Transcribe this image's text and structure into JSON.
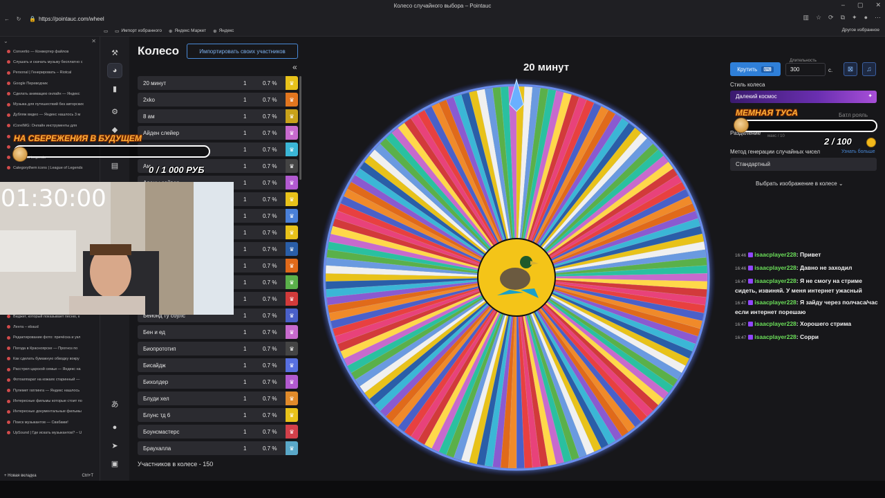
{
  "browser": {
    "title": "Колесо случайного выбора – Pointauc",
    "url": "https://pointauc.com/wheel",
    "bookmarks": [
      "Импорт избранного",
      "Яндекс Маркет",
      "Яндекс"
    ],
    "other_bookmarks": "Другое избранное",
    "new_tab": "Новая вкладка",
    "new_tab_shortcut": "Ctrl+T"
  },
  "browser_sidebar": {
    "items": [
      "Convertio — Конвертер файлов",
      "Слушать и скачать музыку бесплатно с",
      "Personal | Генерировать – Riotcal",
      "Google Переводчик",
      "Сделать анимацию онлайн — Яндекс",
      "Музыка для путешествий без авторских",
      "Дубляж видео — Яндекс нашлось 3 м",
      "iCoreIMG: Онлайн инструменты для",
      "",
      "",
      "League of Legends",
      "Categorythem icons | League of Legends"
    ],
    "items_lower": [
      "Виджет, который показывает песню, к",
      "Лента – ebaud",
      "Редактирование фото: причёска и укл",
      "Погода в Красноярске — Прогноз по",
      "Как сделать бумажную обводку вокру",
      "Расстрел царской семьи — Яндекс на",
      "Фотоаппарат на кожаях старинный —",
      "Пулемет гатлинга — Яндекс нашлось",
      "Интересные фильмы которые стоит по",
      "Интересные документальные фильмы",
      "Поиск музыкантов — Свабами!",
      "UpSound | Где искать музыкантов? – U"
    ]
  },
  "app": {
    "title": "Колесо",
    "import_button": "Импортировать своих участников",
    "footer": "Участников в колесе - 150",
    "participants": [
      {
        "name": "20 минут",
        "count": "1",
        "pct": "0.7 %",
        "color": "#e8c21a"
      },
      {
        "name": "2xko",
        "count": "1",
        "pct": "0.7 %",
        "color": "#e2761f"
      },
      {
        "name": "8 ам",
        "count": "1",
        "pct": "0.7 %",
        "color": "#c9a21a"
      },
      {
        "name": "Айден слейер",
        "count": "1",
        "pct": "0.7 %",
        "color": "#c76acd"
      },
      {
        "name": "",
        "count": "1",
        "pct": "0.7 %",
        "color": "#3bb6d6"
      },
      {
        "name": "Ам",
        "count": "1",
        "pct": "0.7 %",
        "color": "#444"
      },
      {
        "name": "Арены сейвер",
        "count": "1",
        "pct": "0.7 %",
        "color": "#b25ad0"
      },
      {
        "name": "",
        "count": "1",
        "pct": "0.7 %",
        "color": "#e8c21a"
      },
      {
        "name": "",
        "count": "1",
        "pct": "0.7 %",
        "color": "#4a80d8"
      },
      {
        "name": "",
        "count": "1",
        "pct": "0.7 %",
        "color": "#e8c21a"
      },
      {
        "name": "",
        "count": "1",
        "pct": "0.7 %",
        "color": "#2a5ea8"
      },
      {
        "name": "",
        "count": "1",
        "pct": "0.7 %",
        "color": "#e06a1a"
      },
      {
        "name": "",
        "count": "1",
        "pct": "0.7 %",
        "color": "#5ab04a"
      },
      {
        "name": "",
        "count": "1",
        "pct": "0.7 %",
        "color": "#d23a3a"
      },
      {
        "name": "Бейонд ту соулс",
        "count": "1",
        "pct": "0.7 %",
        "color": "#4a60c8"
      },
      {
        "name": "Бен и ед",
        "count": "1",
        "pct": "0.7 %",
        "color": "#c76acd"
      },
      {
        "name": "Биопрототип",
        "count": "1",
        "pct": "0.7 %",
        "color": "#444"
      },
      {
        "name": "Бисайдж",
        "count": "1",
        "pct": "0.7 %",
        "color": "#5870e0"
      },
      {
        "name": "Бихолдер",
        "count": "1",
        "pct": "0.7 %",
        "color": "#b25ad0"
      },
      {
        "name": "Блуди хел",
        "count": "1",
        "pct": "0.7 %",
        "color": "#e08a2a"
      },
      {
        "name": "Блунс тд 6",
        "count": "1",
        "pct": "0.7 %",
        "color": "#e8c21a"
      },
      {
        "name": "Боунсмастерс",
        "count": "1",
        "pct": "0.7 %",
        "color": "#d2404a"
      },
      {
        "name": "Браухалла",
        "count": "1",
        "pct": "0.7 %",
        "color": "#5aa8c8"
      }
    ]
  },
  "wheel": {
    "winner": "20 минут",
    "colors": [
      "#e8c21a",
      "#d23a3a",
      "#3bb6d6",
      "#c76acd",
      "#e06a1a",
      "#5ab04a",
      "#4a60c8",
      "#f0f0f0",
      "#e8427a",
      "#2a5ea8",
      "#ffd84a",
      "#8a5ad0",
      "#2ac0a0",
      "#f08a2a",
      "#6a9ae0",
      "#e84040"
    ],
    "segments": 150
  },
  "controls": {
    "spin_label": "Крутить",
    "duration_label": "Длительность",
    "duration_value": "300",
    "duration_unit": "с.",
    "style_label": "Стиль колеса",
    "style_value": "Далекий космос",
    "modes": [
      "",
      "",
      "Батл рояль"
    ],
    "split_label": "Разделение",
    "split_hint": "макс / 10",
    "rng_label": "Метод генерации случайных чисел",
    "rng_link": "Узнать больше",
    "rng_value": "Стандартный",
    "image_select": "Выбрать изображение в колесе"
  },
  "chat": [
    {
      "time": "16:46",
      "user": "isaacplayer228",
      "text": "Привет"
    },
    {
      "time": "16:46",
      "user": "isaacplayer228",
      "text": "Давно не заходил"
    },
    {
      "time": "16:47",
      "user": "isaacplayer228",
      "text": "Я не смогу на стриме сидеть, извиняй. У меня интернет ужасный"
    },
    {
      "time": "16:47",
      "user": "isaacplayer228",
      "text": "Я зайду через полчаса/час если интернет порешаю"
    },
    {
      "time": "16:47",
      "user": "isaacplayer228",
      "text": "Хорошего стрима"
    },
    {
      "time": "16:47",
      "user": "isaacplayer228",
      "text": "Сорри"
    }
  ],
  "overlays": {
    "goal1_title": "НА СБЕРЕЖЕНИЯ В БУДУЩЕМ",
    "goal1_amount": "0 / 1 000 РУБ",
    "goal2_title": "МЕМНАЯ ТУСА",
    "goal2_amount": "2 / 100",
    "timer": "01:30:00"
  }
}
